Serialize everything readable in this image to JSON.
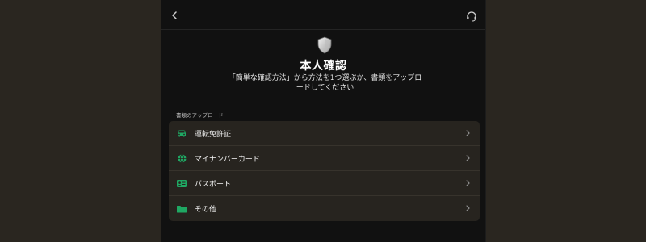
{
  "header": {
    "back_icon": "chevron-left-icon",
    "support_icon": "headset-icon"
  },
  "hero": {
    "icon": "shield-icon",
    "title": "本人確認",
    "subtitle": "「簡単な確認方法」から方法を1つ選ぶか、書類をアップロードしてください"
  },
  "section": {
    "label": "書類のアップロード"
  },
  "options": [
    {
      "label": "運転免許証",
      "icon": "car-icon"
    },
    {
      "label": "マイナンバーカード",
      "icon": "globe-icon"
    },
    {
      "label": "パスポート",
      "icon": "id-card-icon"
    },
    {
      "label": "その他",
      "icon": "folder-icon"
    }
  ],
  "colors": {
    "accent": "#1fa863",
    "panel": "#111111",
    "list_bg": "#27241f",
    "page_bg": "#2a2620"
  }
}
